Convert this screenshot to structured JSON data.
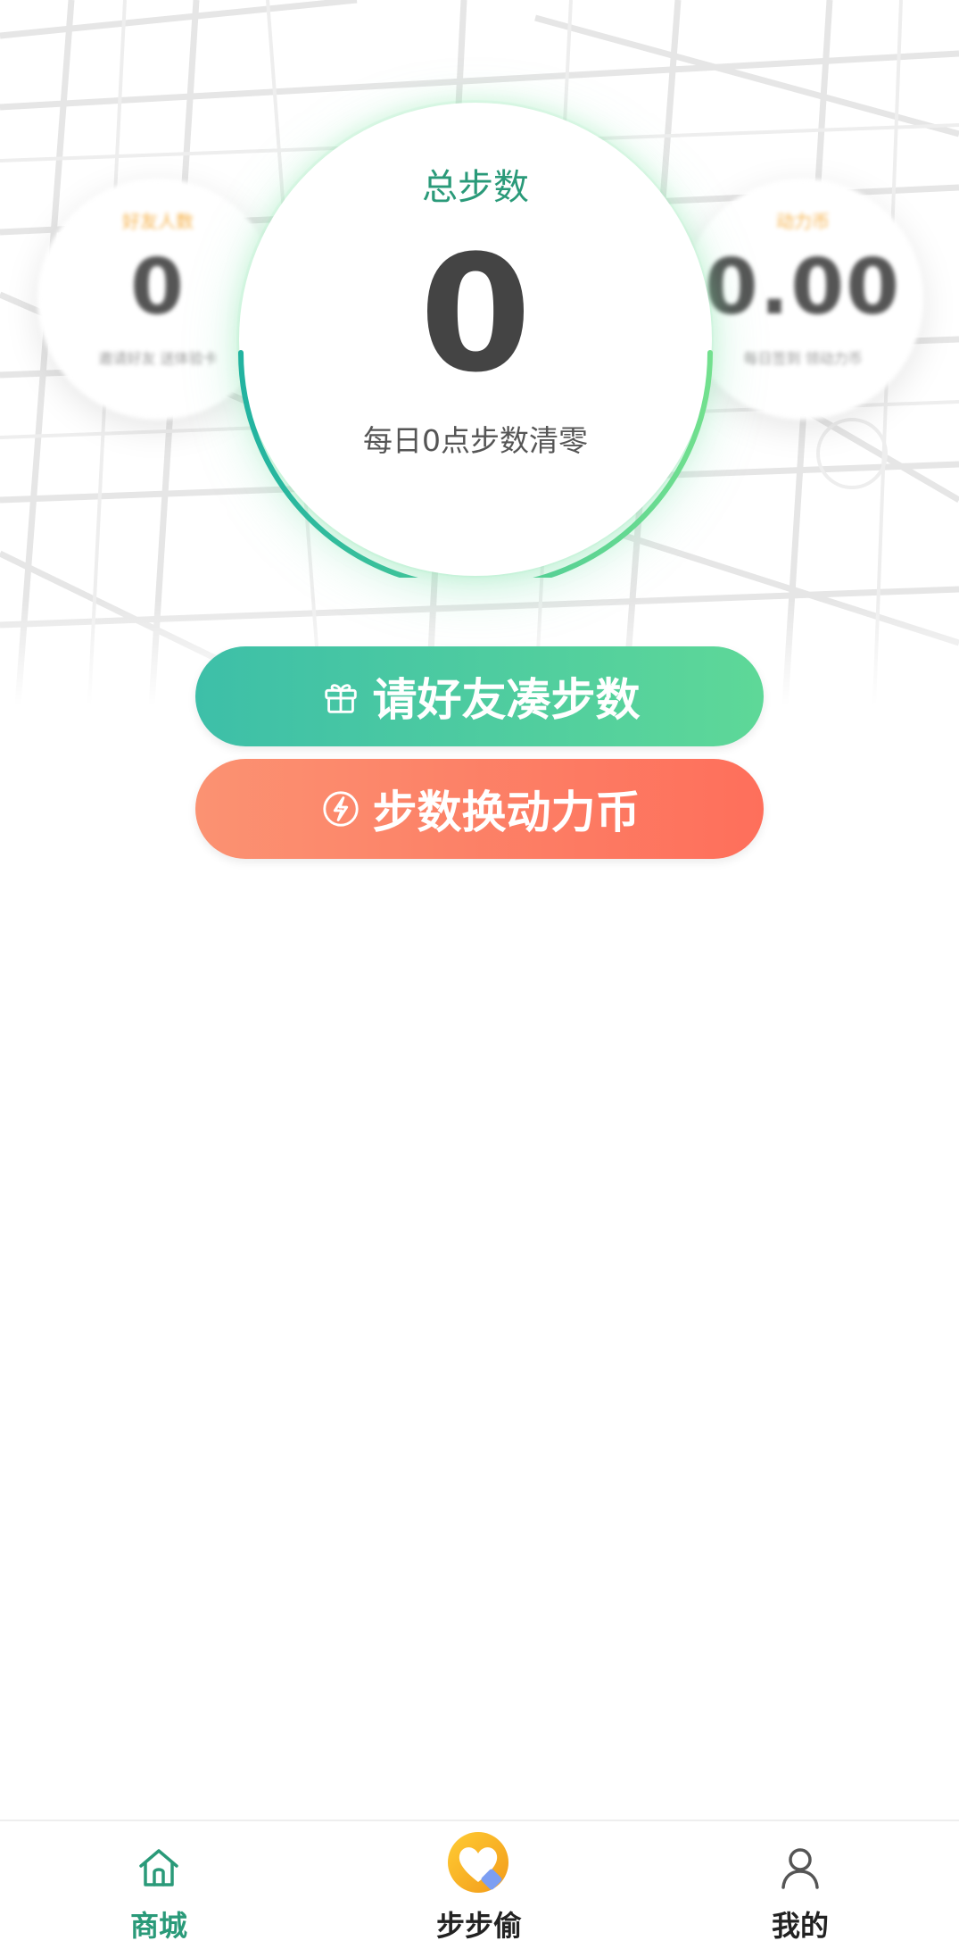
{
  "left_stat": {
    "label": "好友人数",
    "value": "0",
    "sub": "邀请好友 送体验卡"
  },
  "right_stat": {
    "label": "动力币",
    "value": "0.00",
    "sub": "每日签到 领动力币"
  },
  "main": {
    "title": "总步数",
    "value": "0",
    "subtitle": "每日0点步数清零"
  },
  "buttons": {
    "invite_label": "请好友凑步数",
    "exchange_label": "步数换动力币"
  },
  "tabbar": {
    "items": [
      {
        "label": "商城",
        "icon": "home-icon",
        "active": true
      },
      {
        "label": "步步偷",
        "icon": "heart-logo-icon",
        "active": false
      },
      {
        "label": "我的",
        "icon": "user-icon",
        "active": false
      }
    ]
  },
  "colors": {
    "accent_green": "#2a9a79",
    "button_green_start": "#3dbfa8",
    "button_green_end": "#5ed898",
    "button_orange_start": "#fb9272",
    "button_orange_end": "#fe6f5b"
  }
}
